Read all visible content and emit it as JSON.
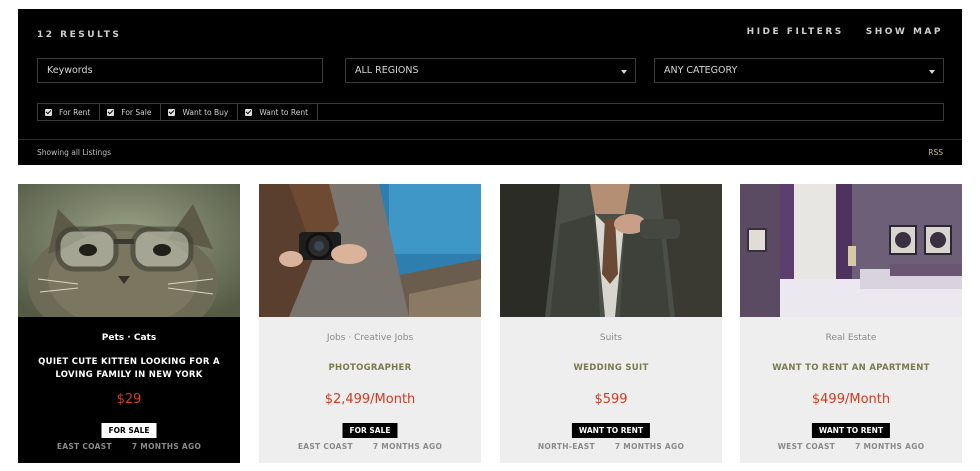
{
  "filters": {
    "results_count": "12 RESULTS",
    "hide_filters": "HIDE FILTERS",
    "show_map": "SHOW MAP",
    "keywords_value": "Keywords",
    "regions_value": "ALL REGIONS",
    "category_value": "ANY CATEGORY",
    "checkboxes": [
      {
        "label": "For Rent",
        "checked": true
      },
      {
        "label": "For Sale",
        "checked": true
      },
      {
        "label": "Want to Buy",
        "checked": true
      },
      {
        "label": "Want to Rent",
        "checked": true
      }
    ],
    "showing_text": "Showing all Listings",
    "rss_label": "RSS"
  },
  "listings": [
    {
      "categories": "Pets · Cats",
      "title": "QUIET CUTE KITTEN LOOKING FOR A LOVING FAMILY IN NEW YORK",
      "price": "$29",
      "badge": "FOR SALE",
      "region": "EAST COAST",
      "age": "7 MONTHS AGO",
      "style": "dark"
    },
    {
      "categories": "Jobs · Creative Jobs",
      "title": "PHOTOGRAPHER",
      "price": "$2,499/Month",
      "badge": "FOR SALE",
      "region": "EAST COAST",
      "age": "7 MONTHS AGO",
      "style": "light"
    },
    {
      "categories": "Suits",
      "title": "WEDDING SUIT",
      "price": "$599",
      "badge": "WANT TO RENT",
      "region": "NORTH-EAST",
      "age": "7 MONTHS AGO",
      "style": "light"
    },
    {
      "categories": "Real Estate",
      "title": "WANT TO RENT AN APARTMENT",
      "price": "$499/Month",
      "badge": "WANT TO RENT",
      "region": "WEST COAST",
      "age": "7 MONTHS AGO",
      "style": "light"
    }
  ],
  "colors": {
    "accent_price": "#d33a1f",
    "title_olive": "#7a7a4e",
    "panel_bg": "#000000",
    "card_bg": "#eeeeee"
  }
}
